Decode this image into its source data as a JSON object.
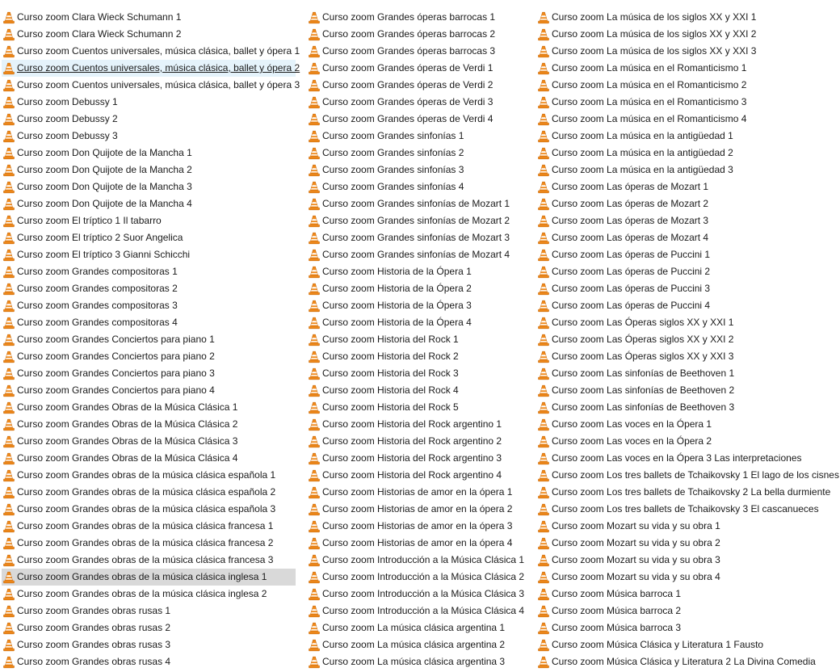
{
  "icon": "vlc-cone-icon",
  "colors": {
    "cone_orange": "#f08a1c",
    "cone_stripe": "#ffffff",
    "hover_bg": "#e5f3fb",
    "selected_bg": "#d9d9d9"
  },
  "columns": [
    [
      "Curso zoom Clara Wieck Schumann 1",
      "Curso zoom Clara Wieck Schumann 2",
      "Curso zoom Cuentos universales, música clásica, ballet y ópera 1",
      "Curso zoom Cuentos universales, música clásica, ballet y ópera 2",
      "Curso zoom Cuentos universales, música clásica, ballet y ópera 3",
      "Curso zoom Debussy 1",
      "Curso zoom Debussy 2",
      "Curso zoom Debussy 3",
      "Curso zoom Don Quijote de la Mancha 1",
      "Curso zoom Don Quijote de la Mancha 2",
      "Curso zoom Don Quijote de la Mancha 3",
      "Curso zoom Don Quijote de la Mancha 4",
      "Curso zoom El tríptico 1 Il tabarro",
      "Curso zoom El tríptico 2 Suor Angelica",
      "Curso zoom El tríptico 3 Gianni Schicchi",
      "Curso zoom Grandes compositoras 1",
      "Curso zoom Grandes compositoras 2",
      "Curso zoom Grandes compositoras 3",
      "Curso zoom Grandes compositoras 4",
      "Curso zoom Grandes Conciertos para piano 1",
      "Curso zoom Grandes Conciertos para piano 2",
      "Curso zoom Grandes Conciertos para piano 3",
      "Curso zoom Grandes Conciertos para piano 4",
      "Curso zoom Grandes Obras de la Música Clásica 1",
      "Curso zoom Grandes Obras de la Música Clásica 2",
      "Curso zoom Grandes Obras de la Música Clásica 3",
      "Curso zoom Grandes Obras de la Música Clásica 4",
      "Curso zoom Grandes obras de la música clásica española 1",
      "Curso zoom Grandes obras de la música clásica española 2",
      "Curso zoom Grandes obras de la música clásica española 3",
      "Curso zoom Grandes obras de la música clásica francesa 1",
      "Curso zoom Grandes obras de la música clásica francesa 2",
      "Curso zoom Grandes obras de la música clásica francesa 3",
      "Curso zoom Grandes obras de la música clásica inglesa 1",
      "Curso zoom Grandes obras de la música clásica inglesa 2",
      "Curso zoom Grandes obras rusas 1",
      "Curso zoom Grandes obras rusas 2",
      "Curso zoom Grandes obras rusas 3",
      "Curso zoom Grandes obras rusas 4"
    ],
    [
      "Curso zoom Grandes óperas barrocas 1",
      "Curso zoom Grandes óperas barrocas 2",
      "Curso zoom Grandes óperas barrocas 3",
      "Curso zoom Grandes óperas de Verdi 1",
      "Curso zoom Grandes óperas de Verdi 2",
      "Curso zoom Grandes óperas de Verdi 3",
      "Curso zoom Grandes óperas de Verdi 4",
      "Curso zoom Grandes sinfonías 1",
      "Curso zoom Grandes sinfonías 2",
      "Curso zoom Grandes sinfonías 3",
      "Curso zoom Grandes sinfonías 4",
      "Curso zoom Grandes sinfonías de Mozart 1",
      "Curso zoom Grandes sinfonías de Mozart 2",
      "Curso zoom Grandes sinfonías de Mozart 3",
      "Curso zoom Grandes sinfonías de Mozart 4",
      "Curso zoom Historia de la Ópera 1",
      "Curso zoom Historia de la Ópera 2",
      "Curso zoom Historia de la Ópera 3",
      "Curso zoom Historia de la Ópera 4",
      "Curso zoom Historia del Rock 1",
      "Curso zoom Historia del Rock 2",
      "Curso zoom Historia del Rock 3",
      "Curso zoom Historia del Rock 4",
      "Curso zoom Historia del Rock 5",
      "Curso zoom Historia del Rock argentino 1",
      "Curso zoom Historia del Rock argentino 2",
      "Curso zoom Historia del Rock argentino 3",
      "Curso zoom Historia del Rock argentino 4",
      "Curso zoom Historias de amor en la ópera 1",
      "Curso zoom Historias de amor en la ópera 2",
      "Curso zoom Historias de amor en la ópera 3",
      "Curso zoom Historias de amor en la ópera 4",
      "Curso zoom Introducción a la Música Clásica 1",
      "Curso zoom Introducción a la Música Clásica 2",
      "Curso zoom Introducción a la Música Clásica 3",
      "Curso zoom Introducción a la Música Clásica 4",
      "Curso zoom La música clásica argentina 1",
      "Curso zoom La música clásica argentina 2",
      "Curso zoom La música clásica argentina 3"
    ],
    [
      "Curso zoom La música de los siglos XX y XXI 1",
      "Curso zoom La música de los siglos XX y XXI 2",
      "Curso zoom La música de los siglos XX y XXI 3",
      "Curso zoom La música en el Romanticismo 1",
      "Curso zoom La música en el Romanticismo 2",
      "Curso zoom La música en el Romanticismo 3",
      "Curso zoom La música en el Romanticismo 4",
      "Curso zoom La música en la antigüedad 1",
      "Curso zoom La música en la antigüedad 2",
      "Curso zoom La música en la antigüedad 3",
      "Curso zoom Las óperas de Mozart 1",
      "Curso zoom Las óperas de Mozart 2",
      "Curso zoom Las óperas de Mozart 3",
      "Curso zoom Las óperas de Mozart 4",
      "Curso zoom Las óperas de Puccini 1",
      "Curso zoom Las óperas de Puccini 2",
      "Curso zoom Las óperas de Puccini 3",
      "Curso zoom Las óperas de Puccini 4",
      "Curso zoom Las Óperas siglos XX y XXI 1",
      "Curso zoom Las Óperas siglos XX y XXI 2",
      "Curso zoom Las Óperas siglos XX y XXI 3",
      "Curso zoom Las sinfonías de Beethoven 1",
      "Curso zoom Las sinfonías de Beethoven 2",
      "Curso zoom Las sinfonías de Beethoven 3",
      "Curso zoom Las voces en la Ópera 1",
      "Curso zoom Las voces en la Ópera 2",
      "Curso zoom Las voces en la Ópera 3 Las interpretaciones",
      "Curso zoom Los tres ballets de Tchaikovsky 1 El lago de los cisnes",
      "Curso zoom Los tres ballets de Tchaikovsky 2 La bella durmiente",
      "Curso zoom Los tres ballets de Tchaikovsky 3 El cascanueces",
      "Curso zoom Mozart su vida y su obra 1",
      "Curso zoom Mozart su vida y su obra 2",
      "Curso zoom Mozart su vida y su obra 3",
      "Curso zoom Mozart su vida y su obra 4",
      "Curso zoom Música barroca 1",
      "Curso zoom Música barroca 2",
      "Curso zoom Música barroca 3",
      "Curso zoom Música Clásica y Literatura 1 Fausto",
      "Curso zoom Música Clásica y Literatura 2 La Divina Comedia"
    ]
  ],
  "hovered": {
    "column": 0,
    "index": 3
  },
  "selected": {
    "column": 0,
    "index": 33
  }
}
